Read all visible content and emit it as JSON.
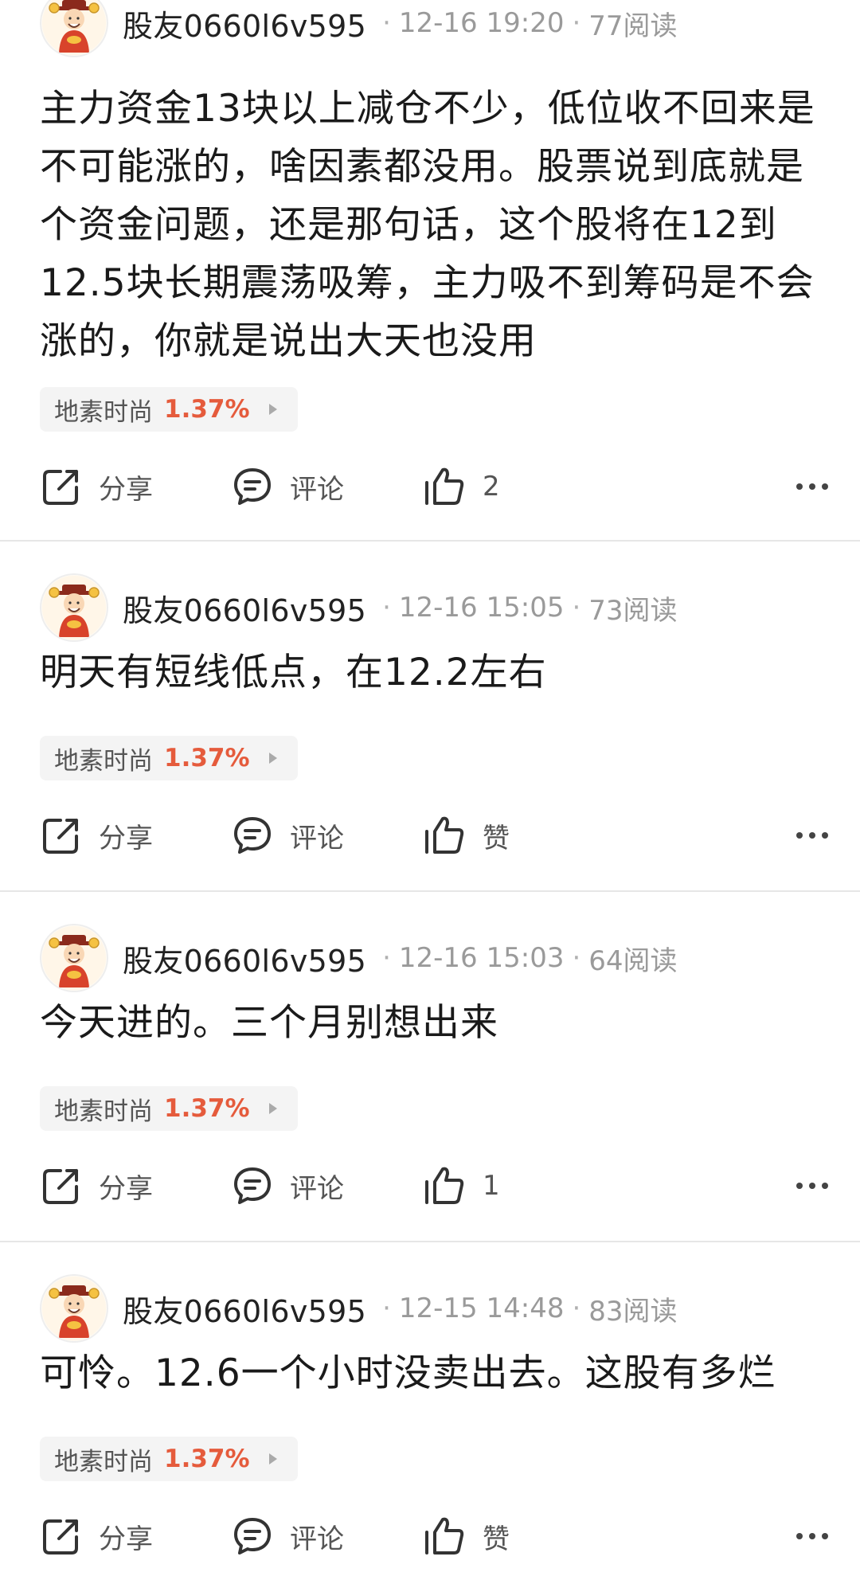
{
  "posts": [
    {
      "username": "股友0660l6v595",
      "time": "12-16 19:20",
      "reads": "77阅读",
      "content": "主力资金13块以上减仓不少，低位收不回来是不可能涨的，啥因素都没用。股票说到底就是个资金问题，还是那句话，这个股将在12到12.5块长期震荡吸筹，主力吸不到筹码是不会涨的，你就是说出大天也没用",
      "stock_name": "地素时尚",
      "stock_change": "1.37%",
      "share_label": "分享",
      "comment_label": "评论",
      "like_label": "2"
    },
    {
      "username": "股友0660l6v595",
      "time": "12-16 15:05",
      "reads": "73阅读",
      "content": "明天有短线低点，在12.2左右",
      "stock_name": "地素时尚",
      "stock_change": "1.37%",
      "share_label": "分享",
      "comment_label": "评论",
      "like_label": "赞"
    },
    {
      "username": "股友0660l6v595",
      "time": "12-16 15:03",
      "reads": "64阅读",
      "content": "今天进的。三个月别想出来",
      "stock_name": "地素时尚",
      "stock_change": "1.37%",
      "share_label": "分享",
      "comment_label": "评论",
      "like_label": "1"
    },
    {
      "username": "股友0660l6v595",
      "time": "12-15 14:48",
      "reads": "83阅读",
      "content": "可怜。12.6一个小时没卖出去。这股有多烂",
      "stock_name": "地素时尚",
      "stock_change": "1.37%",
      "share_label": "分享",
      "comment_label": "评论",
      "like_label": "赞"
    }
  ],
  "colors": {
    "change_up": "#e55b3c",
    "meta_gray": "#9a9a9a",
    "tag_bg": "#f4f4f4"
  },
  "icons": {
    "avatar": "god-of-wealth-avatar-icon",
    "share": "share-icon",
    "comment": "comment-icon",
    "like": "thumbs-up-icon",
    "more": "more-dots-icon"
  }
}
